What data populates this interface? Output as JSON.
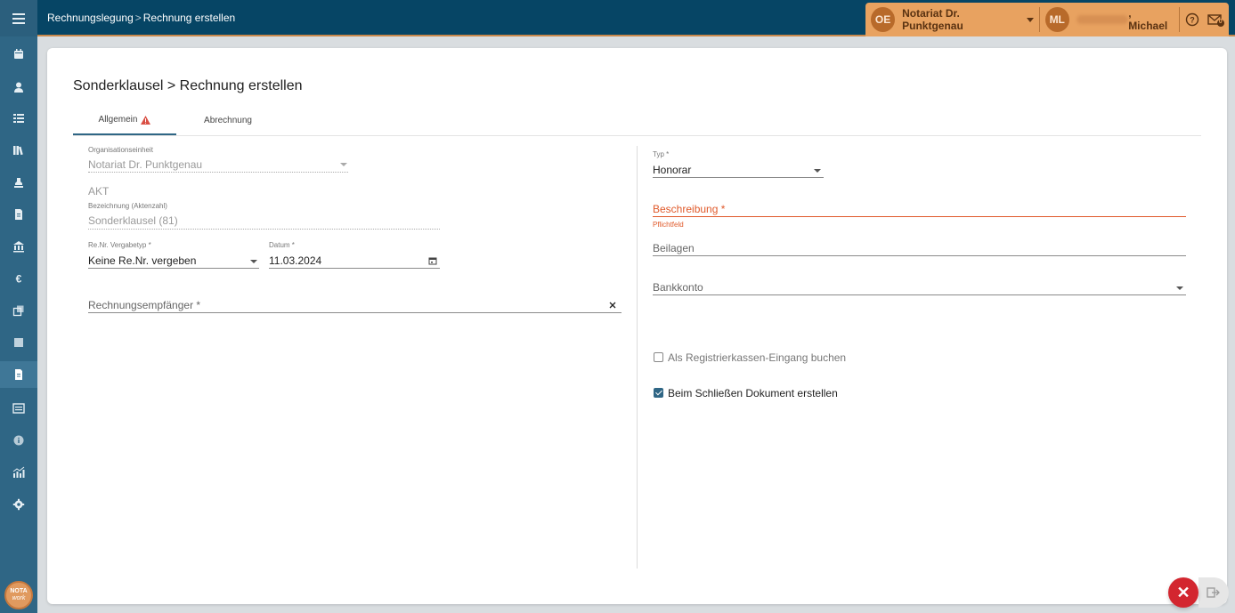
{
  "topbar": {
    "breadcrumb_root": "Rechnungslegung",
    "breadcrumb_sep": ">",
    "breadcrumb_current": "Rechnung erstellen",
    "org_initials": "OE",
    "org_name": "Notariat Dr. Punktgenau",
    "user_initials": "ML",
    "user_name": ", Michael",
    "mail_badge": "0"
  },
  "sidebar": {
    "items": [
      "calendar-icon",
      "person-icon",
      "list-icon",
      "books-icon",
      "stamp-icon",
      "document-icon",
      "bank-icon",
      "euro-icon",
      "copy-icon",
      "square-icon",
      "invoice-icon",
      "ledger-icon",
      "info-icon",
      "chart-icon",
      "gear-icon"
    ],
    "logo_top": "NOTA",
    "logo_bottom": "work"
  },
  "page": {
    "title": "Sonderklausel > Rechnung erstellen",
    "tabs": [
      {
        "label": "Allgemein"
      },
      {
        "label": "Abrechnung"
      }
    ]
  },
  "left": {
    "org_label": "Organisationseinheit",
    "org_value": "Notariat Dr. Punktgenau",
    "akt_label": "AKT",
    "bezeichnung_label": "Bezeichnung (Aktenzahl)",
    "bezeichnung_value": "Sonderklausel (81)",
    "renr_label": "Re.Nr. Vergabetyp *",
    "renr_value": "Keine Re.Nr. vergeben",
    "datum_label": "Datum *",
    "datum_value": "11.03.2024",
    "empfaenger_placeholder": "Rechnungsempfänger *"
  },
  "right": {
    "typ_label": "Typ *",
    "typ_value": "Honorar",
    "beschreibung_placeholder": "Beschreibung *",
    "beschreibung_error": "Pflichtfeld",
    "beilagen_placeholder": "Beilagen",
    "bankkonto_placeholder": "Bankkonto",
    "checkbox_register": "Als Registrierkassen-Eingang buchen",
    "checkbox_register_checked": false,
    "checkbox_document": "Beim Schließen Dokument erstellen",
    "checkbox_document_checked": true
  },
  "actions": {
    "close_symbol": "✕"
  },
  "colors": {
    "topbar": "#064565",
    "sidebar": "#2f6685",
    "accent_orange": "#e8a260",
    "error": "#e05a2b",
    "close_button": "#d3262f"
  }
}
